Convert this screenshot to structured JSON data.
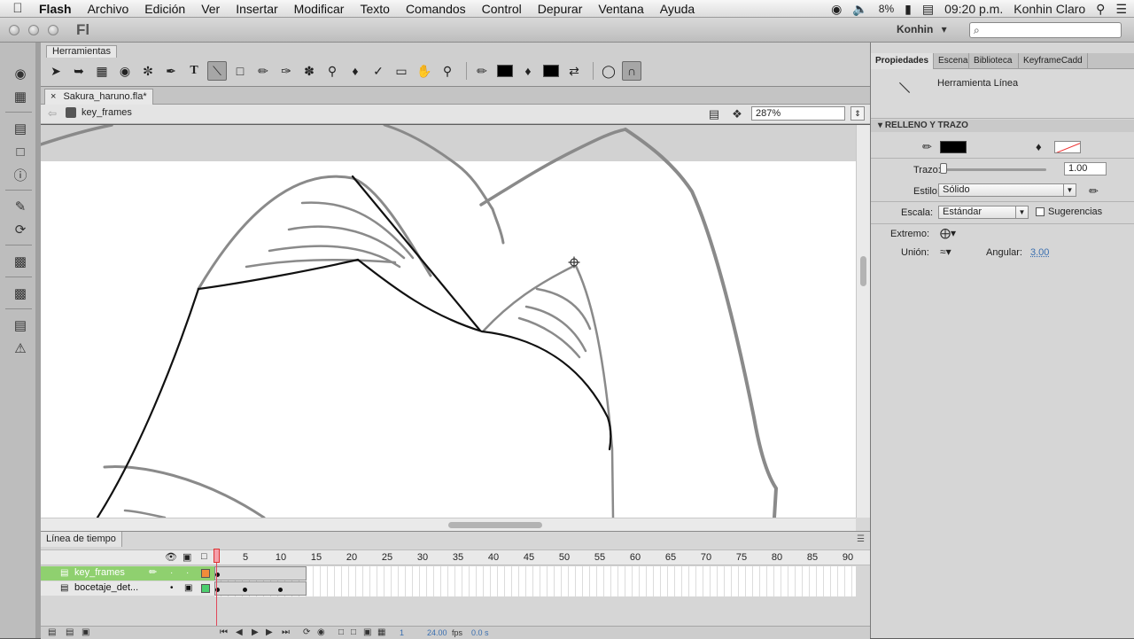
{
  "menubar": {
    "apple_icon": "",
    "app_name": "Flash",
    "menus": [
      "Archivo",
      "Edición",
      "Ver",
      "Insertar",
      "Modificar",
      "Texto",
      "Comandos",
      "Control",
      "Depurar",
      "Ventana",
      "Ayuda"
    ],
    "battery": "8%",
    "time": "09:20 p.m.",
    "user": "Konhin Claro"
  },
  "appbar": {
    "logo": "Fl",
    "workspace": "Konhin",
    "workspace_arrow": "▾",
    "search_icon": "⌕"
  },
  "tools_panel": {
    "tab_label": "Herramientas"
  },
  "document": {
    "tab_label": "Sakura_haruno.fla*",
    "close": "×",
    "scene_label": "key_frames",
    "zoom": "287%"
  },
  "timeline": {
    "tab_label": "Línea de tiempo",
    "ruler": [
      "1",
      "5",
      "10",
      "15",
      "20",
      "25",
      "30",
      "35",
      "40",
      "45",
      "50",
      "55",
      "60",
      "65",
      "70",
      "75",
      "80",
      "85",
      "90"
    ],
    "layers": [
      {
        "name": "key_frames",
        "active": true
      },
      {
        "name": "bocetaje_det..."
      }
    ],
    "footer": {
      "frame": "1",
      "fps": "24.00",
      "fps_unit": "fps",
      "time": "0.0 s"
    }
  },
  "properties": {
    "tabs": [
      "Propiedades",
      "Escena",
      "Biblioteca",
      "KeyframeCadd"
    ],
    "tool_name": "Herramienta Línea",
    "section_title": "RELLENO Y TRAZO",
    "stroke_label": "Trazo:",
    "stroke_value": "1.00",
    "style_label": "Estilo:",
    "style_value": "Sólido",
    "scale_label": "Escala:",
    "scale_value": "Estándar",
    "hints_label": "Sugerencias",
    "cap_label": "Extremo:",
    "join_label": "Unión:",
    "miter_label": "Angular:",
    "miter_value": "3.00"
  },
  "colors": {
    "layer_active": "#8fd06f",
    "stroke_color": "#000000",
    "sketch_color": "#8a8a8a",
    "playhead": "#e0475a"
  }
}
